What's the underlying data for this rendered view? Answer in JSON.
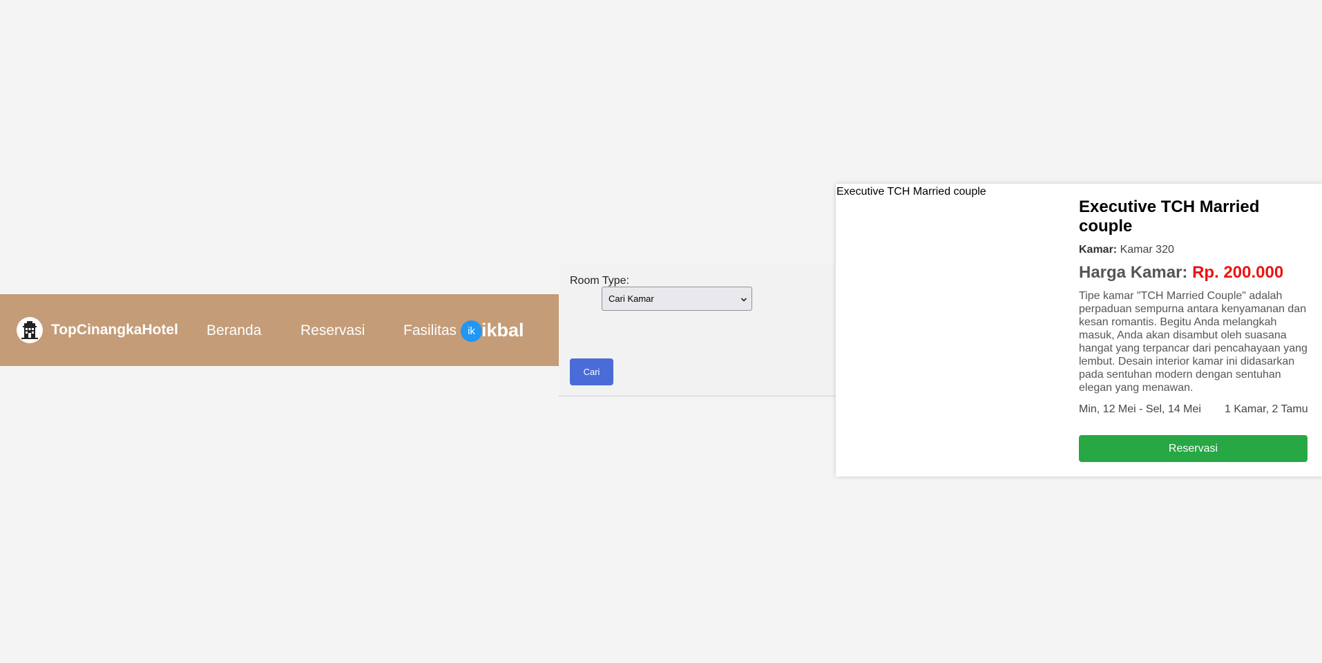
{
  "navbar": {
    "brand": "TopCinangkaHotel",
    "brand_icon": "hotel-building-icon",
    "links": [
      "Beranda",
      "Reservasi",
      "Fasilitas"
    ],
    "user": {
      "avatar_initials": "ik",
      "username": "ikbal"
    },
    "colors": {
      "background": "#c49c77",
      "avatar": "#2196f3"
    }
  },
  "search": {
    "room_type_label": "Room Type:",
    "select_value": "Cari Kamar",
    "button_label": "Cari",
    "button_color": "#4a6cd8"
  },
  "room": {
    "image_alt": "Executive TCH Married couple",
    "title": "Executive TCH Married couple",
    "room_label": "Kamar:",
    "room_value": "Kamar 320",
    "price_label": "Harga Kamar:",
    "price_value": "Rp. 200.000",
    "description": "Tipe kamar \"TCH Married Couple\" adalah perpaduan sempurna antara kenyamanan dan kesan romantis. Begitu Anda melangkah masuk, Anda akan disambut oleh suasana hangat yang terpancar dari pencahayaan yang lembut. Desain interior kamar ini didasarkan pada sentuhan modern dengan sentuhan elegan yang menawan.",
    "dates": "Min, 12 Mei - Sel, 14 Mei",
    "guests": "1 Kamar, 2 Tamu",
    "reserve_button": "Reservasi",
    "colors": {
      "price": "#ee1111",
      "reserve_button": "#28a745"
    }
  }
}
